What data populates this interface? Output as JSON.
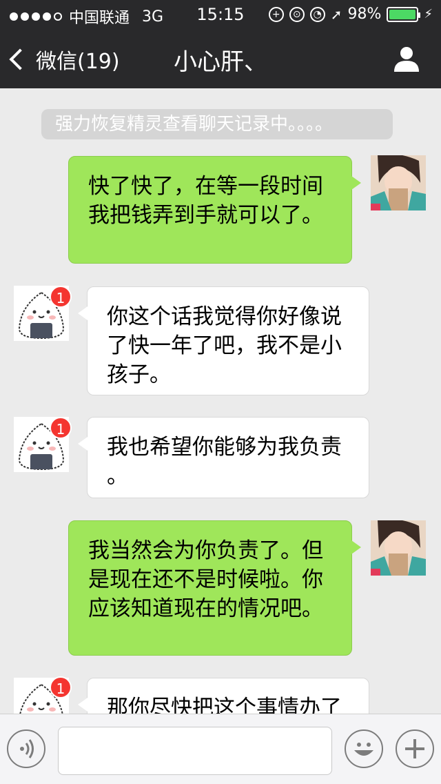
{
  "status_bar": {
    "carrier": "中国联通",
    "network": "3G",
    "time": "15:15",
    "battery": "98%",
    "battery_level": 0.98,
    "battery_color": "#4cd964"
  },
  "nav": {
    "back_label": "微信(19)",
    "title": "小心肝、",
    "right_icon": "person-icon"
  },
  "chat": {
    "system_notice": "强力恢复精灵查看聊天记录中。。。。",
    "messages": [
      {
        "side": "right",
        "text_lines": [
          "快了快了，在等一段时间",
          "我把钱弄到手就可以了。"
        ]
      },
      {
        "side": "left",
        "badge": "1",
        "text_lines": [
          "你这个话我觉得你好像说",
          "了快一年了吧，我不是小",
          "孩子。"
        ]
      },
      {
        "side": "left",
        "badge": "1",
        "text_lines": [
          "我也希望你能够为我负责",
          "。"
        ]
      },
      {
        "side": "right",
        "text_lines": [
          "我当然会为你负责了。但",
          "是现在还不是时候啦。你",
          "应该知道现在的情况吧。"
        ]
      },
      {
        "side": "left",
        "badge": "1",
        "text_lines": [
          "那你尽快把这个事情办了"
        ]
      }
    ]
  },
  "input_bar": {
    "voice_icon": "voice-icon",
    "emoji_icon": "emoji-icon",
    "plus_icon": "plus-icon",
    "text_value": ""
  },
  "colors": {
    "sent_bubble": "#9fe65a",
    "received_bubble": "#ffffff",
    "badge": "#f43530",
    "nav_bg": "#29292b"
  }
}
